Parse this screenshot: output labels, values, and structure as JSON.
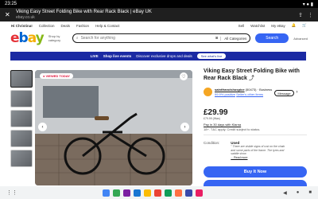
{
  "status_bar": {
    "time": "23:25"
  },
  "browser": {
    "close": "✕",
    "title": "Viking Easy Street Folding Bike with Rear Rack Black | eBay UK",
    "domain": "ebay.co.uk",
    "share_icon": "share-icon",
    "menu_icon": "more-vert-icon"
  },
  "top_nav": {
    "greeting": "Hi Christina!",
    "links": [
      "Collection",
      "Deals",
      "Fashion",
      "Help & Contact"
    ],
    "right": [
      "Sell",
      "Watchlist",
      "My eBay"
    ]
  },
  "header": {
    "logo": "ebay",
    "shop_by_category": "Shop by category",
    "search_placeholder": "Search for anything",
    "category": "All Categories",
    "search_button": "Search",
    "advanced": "Advanced"
  },
  "promo": {
    "live": "LIVE",
    "headline": "Shop live events",
    "text": "Discover exclusive drops and deals",
    "button": "See what's live"
  },
  "gallery": {
    "badge": "● VIEWED TODAY",
    "prev": "‹",
    "next": "›"
  },
  "listing": {
    "title": "Viking Easy Street Folding Bike with Rear Rack Black",
    "title_suffix": "⤴",
    "seller_name": "saintfrancishospice",
    "seller_count": "(50473)",
    "seller_type": "· Business",
    "seller_feedback": "99.9% positive",
    "seller_other": "Seller's other items",
    "message": "Message",
    "price": "£29.99",
    "was_price": "£79.99 (Was)",
    "klarna": "Pay in 30 days with Klarna",
    "vat": "18+. T&C apply. Credit subject to status.",
    "condition_label": "Condition:",
    "condition_value": "Used",
    "condition_desc": "\" There are visible signs of rust on the chain and some parts of the frame. The tyres and saddle show",
    "read_more": "... Read more",
    "buy_button": "Buy It Now"
  },
  "colors": {
    "ebay_blue": "#3665f3",
    "promo_bg": "#1b2aa3",
    "badge_red": "#e0103a"
  }
}
